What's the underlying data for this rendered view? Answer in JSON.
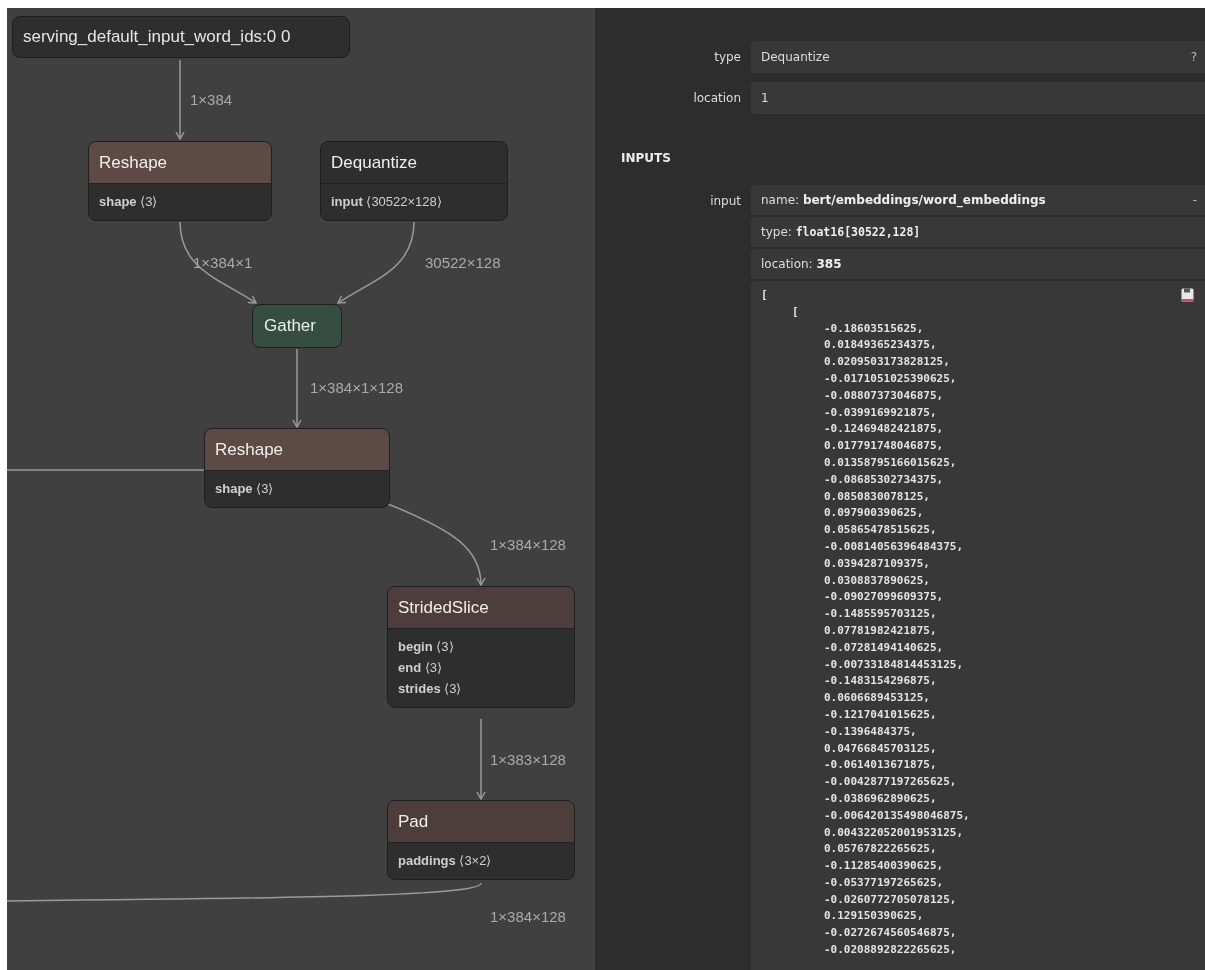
{
  "graph": {
    "nodes": [
      {
        "kind": "input",
        "title": "serving_default_input_word_ids:0 0"
      },
      {
        "kind": "op",
        "title": "Reshape",
        "color": "#5e4a45",
        "attributes": [
          {
            "name": "shape",
            "value": "⟨3⟩"
          }
        ]
      },
      {
        "kind": "op",
        "title": "Dequantize",
        "color": "#2e2e2e",
        "attributes": [
          {
            "name": "input",
            "value": "⟨30522×128⟩"
          }
        ]
      },
      {
        "kind": "op",
        "title": "Gather",
        "color": "#354d42"
      },
      {
        "kind": "op",
        "title": "Reshape",
        "color": "#5e4a45",
        "attributes": [
          {
            "name": "shape",
            "value": "⟨3⟩"
          }
        ]
      },
      {
        "kind": "op",
        "title": "StridedSlice",
        "color": "#4e3e3b",
        "attributes": [
          {
            "name": "begin",
            "value": "⟨3⟩"
          },
          {
            "name": "end",
            "value": "⟨3⟩"
          },
          {
            "name": "strides",
            "value": "⟨3⟩"
          }
        ]
      },
      {
        "kind": "op",
        "title": "Pad",
        "color": "#4e3e3b",
        "attributes": [
          {
            "name": "paddings",
            "value": "⟨3×2⟩"
          }
        ]
      }
    ],
    "edges": [
      {
        "label": "1×384"
      },
      {
        "label": "1×384×1"
      },
      {
        "label": "30522×128"
      },
      {
        "label": "1×384×1×128"
      },
      {
        "label": "1×384×128"
      },
      {
        "label": "1×383×128"
      },
      {
        "label": "1×384×128"
      }
    ]
  },
  "properties": {
    "rows": [
      {
        "label": "type",
        "value": "Dequantize",
        "action": "?"
      },
      {
        "label": "location",
        "value": "1"
      }
    ],
    "section": "INPUTS",
    "inputs": [
      {
        "label": "input",
        "name_label": "name:",
        "name": "bert/embeddings/word_embeddings",
        "action": "-",
        "type_label": "type:",
        "type": "float16[30522,128]",
        "location_label": "location:",
        "location": "385",
        "data": {
          "open": "[",
          "children": [
            {
              "open": "[",
              "values": [
                "-0.18603515625,",
                "0.01849365234375,",
                "0.0209503173828125,",
                "-0.0171051025390625,",
                "-0.08807373046875,",
                "-0.0399169921875,",
                "-0.12469482421875,",
                "0.017791748046875,",
                "0.01358795166015625,",
                "-0.08685302734375,",
                "0.0850830078125,",
                "0.097900390625,",
                "0.05865478515625,",
                "-0.00814056396484375,",
                "0.0394287109375,",
                "0.0308837890625,",
                "-0.09027099609375,",
                "-0.1485595703125,",
                "0.07781982421875,",
                "-0.07281494140625,",
                "-0.00733184814453125,",
                "-0.1483154296875,",
                "0.0606689453125,",
                "-0.1217041015625,",
                "-0.1396484375,",
                "0.04766845703125,",
                "-0.0614013671875,",
                "-0.0042877197265625,",
                "-0.0386962890625,",
                "-0.006420135498046875,",
                "0.004322052001953125,",
                "0.05767822265625,",
                "-0.11285400390625,",
                "-0.05377197265625,",
                "-0.0260772705078125,",
                "0.129150390625,",
                "-0.0272674560546875,",
                "-0.0208892822265625,"
              ]
            }
          ]
        }
      }
    ]
  }
}
